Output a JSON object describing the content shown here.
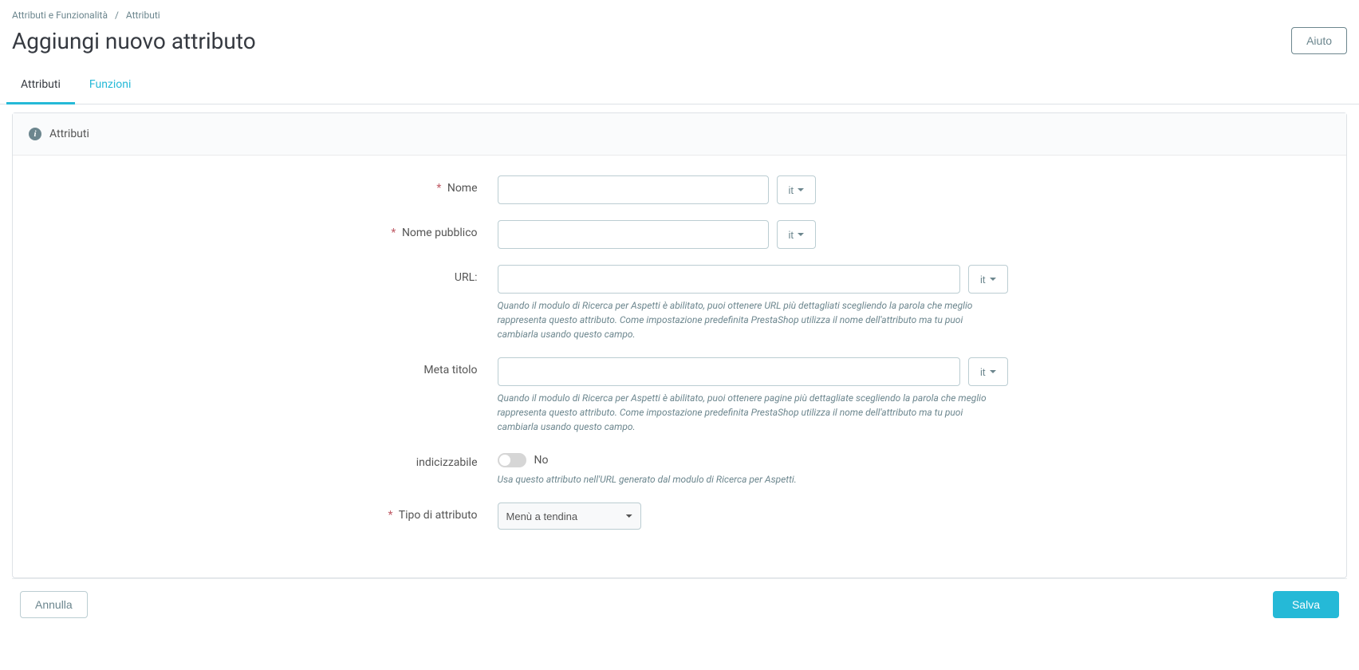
{
  "breadcrumb": {
    "root": "Attributi e Funzionalità",
    "current": "Attributi"
  },
  "header": {
    "title": "Aggiungi nuovo attributo",
    "help_label": "Aiuto"
  },
  "tabs": {
    "attributes": "Attributi",
    "features": "Funzioni"
  },
  "panel": {
    "title": "Attributi"
  },
  "form": {
    "name": {
      "label": "Nome",
      "value": "",
      "lang": "it"
    },
    "public_name": {
      "label": "Nome pubblico",
      "value": "",
      "lang": "it"
    },
    "url": {
      "label": "URL:",
      "value": "",
      "lang": "it",
      "help": "Quando il modulo di Ricerca per Aspetti è abilitato, puoi ottenere URL più dettagliati scegliendo la parola che meglio rappresenta questo attributo. Come impostazione predefinita PrestaShop utilizza il nome dell'attributo ma tu puoi cambiarla usando questo campo."
    },
    "meta_title": {
      "label": "Meta titolo",
      "value": "",
      "lang": "it",
      "help": "Quando il modulo di Ricerca per Aspetti è abilitato, puoi ottenere pagine più dettagliate scegliendo la parola che meglio rappresenta questo attributo. Come impostazione predefinita PrestaShop utilizza il nome dell'attributo ma tu puoi cambiarla usando questo campo."
    },
    "indexable": {
      "label": "indicizzabile",
      "value_label": "No",
      "help": "Usa questo attributo nell'URL generato dal modulo di Ricerca per Aspetti."
    },
    "attribute_type": {
      "label": "Tipo di attributo",
      "selected": "Menù a tendina"
    }
  },
  "footer": {
    "cancel": "Annulla",
    "save": "Salva"
  }
}
